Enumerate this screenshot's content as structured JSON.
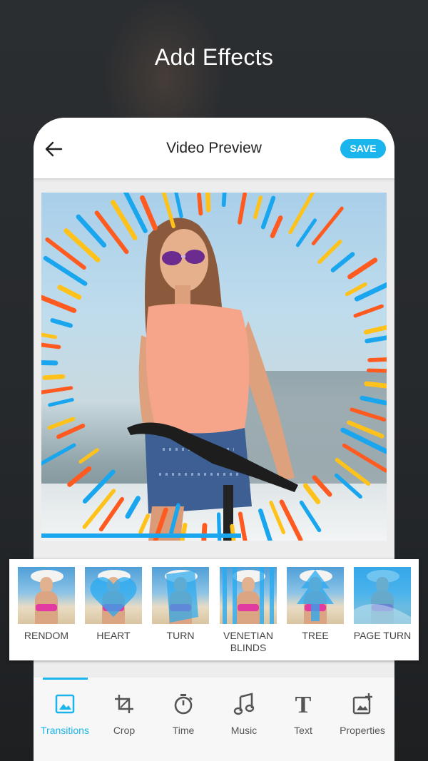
{
  "promo": {
    "headline": "Add Effects"
  },
  "appbar": {
    "title": "Video Preview",
    "save_label": "SAVE"
  },
  "colors": {
    "accent": "#1bb5ee",
    "frame_orange": "#ff5a1f",
    "frame_yellow": "#ffc21a",
    "frame_blue": "#19a6ef"
  },
  "preview": {
    "frame_style": "sunburst-streaks"
  },
  "effects": [
    {
      "label": "RENDOM",
      "icon": "plain"
    },
    {
      "label": "HEART",
      "icon": "heart-overlay"
    },
    {
      "label": "TURN",
      "icon": "turn-overlay"
    },
    {
      "label": "VENETIAN\nBLINDS",
      "icon": "blinds-overlay"
    },
    {
      "label": "TREE",
      "icon": "tree-overlay"
    },
    {
      "label": "PAGE TURN",
      "icon": "page-turn-overlay"
    }
  ],
  "tabs": [
    {
      "label": "Transitions",
      "icon": "image-icon",
      "active": true
    },
    {
      "label": "Crop",
      "icon": "crop-icon",
      "active": false
    },
    {
      "label": "Time",
      "icon": "timer-icon",
      "active": false
    },
    {
      "label": "Music",
      "icon": "music-note-icon",
      "active": false
    },
    {
      "label": "Text",
      "icon": "text-icon",
      "active": false
    },
    {
      "label": "Properties",
      "icon": "add-photo-icon",
      "active": false
    }
  ]
}
